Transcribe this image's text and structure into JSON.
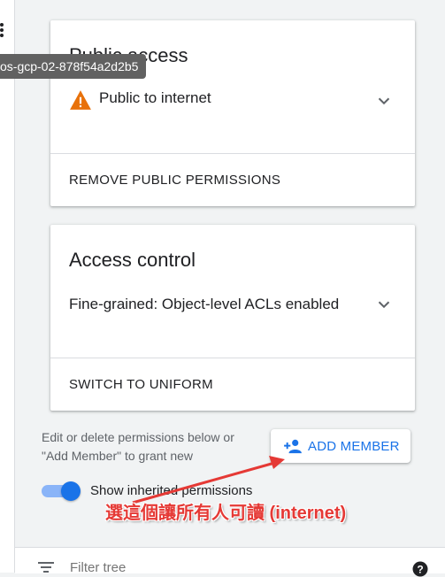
{
  "tooltip": "os-gcp-02-878f54a2d2b5",
  "public_access": {
    "title": "Public access",
    "status": "Public to internet",
    "action": "REMOVE PUBLIC PERMISSIONS",
    "warning_color": "#e8710a"
  },
  "access_control": {
    "title": "Access control",
    "mode": "Fine-grained: Object-level ACLs enabled",
    "action": "SWITCH TO UNIFORM"
  },
  "permissions": {
    "help_text": "Edit or delete permissions below or \"Add Member\" to grant new",
    "add_member_label": "ADD MEMBER",
    "show_inherited_label": "Show inherited permissions",
    "show_inherited_on": true
  },
  "annotation": {
    "text": "選這個讓所有人可讀 (internet)",
    "color": "#e53935"
  },
  "filter": {
    "placeholder": "Filter tree"
  },
  "colors": {
    "accent": "#1a73e8",
    "toggle_track": "#8ab4f8"
  },
  "icons": [
    "more-vert-icon",
    "warning-icon",
    "chevron-down-icon",
    "person-add-icon",
    "filter-icon",
    "help-icon"
  ]
}
